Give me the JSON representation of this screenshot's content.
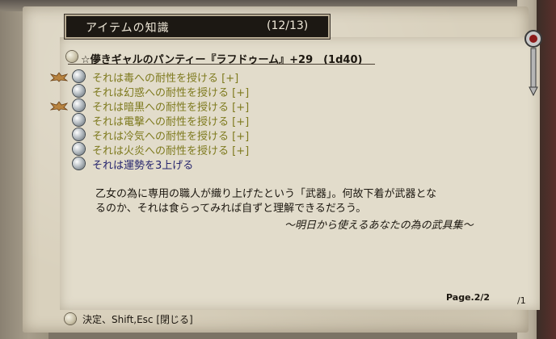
{
  "window": {
    "title": "アイテムの知識",
    "count": "(12/13)"
  },
  "item": {
    "name": "☆儚きギャルのパンティー『ラフドゥーム』+29　(1d40)"
  },
  "effects": [
    {
      "text": "それは毒への耐性を授ける [+]",
      "crest": true
    },
    {
      "text": "それは幻惑への耐性を授ける [+]",
      "crest": false
    },
    {
      "text": "それは暗黒への耐性を授ける [+]",
      "crest": true
    },
    {
      "text": "それは電撃への耐性を授ける [+]",
      "crest": false
    },
    {
      "text": "それは冷気への耐性を授ける [+]",
      "crest": false
    },
    {
      "text": "それは火炎への耐性を授ける [+]",
      "crest": false
    },
    {
      "text": "それは運勢を3上げる",
      "crest": false
    }
  ],
  "description": {
    "line1": "乙女の為に専用の職人が織り上げたという「武器」。何故下着が武器とな",
    "line2": "るのか、それは食らってみれば自ずと理解できるだろう。",
    "flavor": "〜明日から使えるあなたの為の武具集〜"
  },
  "page": "Page.2/2",
  "help": {
    "text": "決定、Shift,Esc [閉じる]"
  },
  "side_fraction": "/1",
  "colors": {
    "panel": "#d9d1bd",
    "title_bg": "#1c1813",
    "resist_text": "#7e7a1e",
    "luck_text": "#25246d"
  },
  "icons": [
    "orb-icon",
    "crest-icon",
    "hint-icon",
    "info-icon"
  ]
}
